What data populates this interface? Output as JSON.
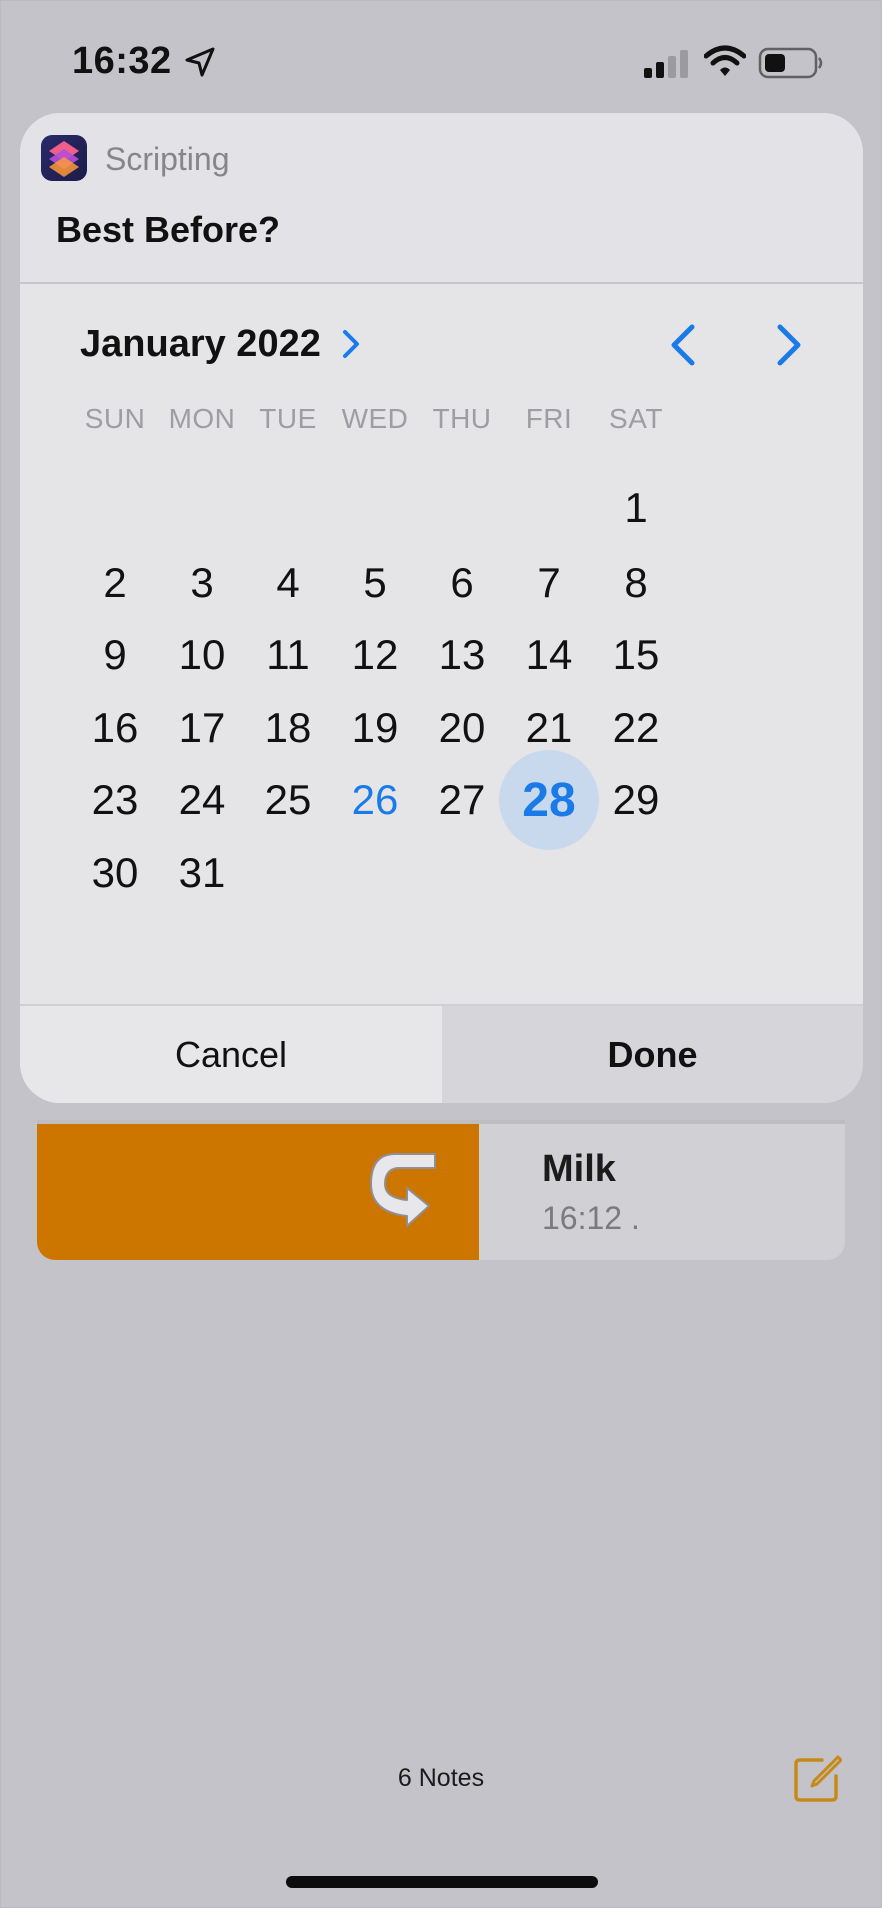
{
  "status_bar": {
    "time": "16:32"
  },
  "dialog": {
    "app_name": "Scripting",
    "title": "Best Before?",
    "month_label": "January 2022",
    "weekdays": [
      "SUN",
      "MON",
      "TUE",
      "WED",
      "THU",
      "FRI",
      "SAT"
    ],
    "days": [
      "1",
      "2",
      "3",
      "4",
      "5",
      "6",
      "7",
      "8",
      "9",
      "10",
      "11",
      "12",
      "13",
      "14",
      "15",
      "16",
      "17",
      "18",
      "19",
      "20",
      "21",
      "22",
      "23",
      "24",
      "25",
      "26",
      "27",
      "28",
      "29",
      "30",
      "31"
    ],
    "first_weekday_index": 6,
    "today": "26",
    "selected": "28",
    "cancel_label": "Cancel",
    "done_label": "Done"
  },
  "note": {
    "title": "Milk",
    "subtitle": "16:12  ."
  },
  "toolbar": {
    "notes_count": "6 Notes"
  },
  "colors": {
    "accent": "#1a7be8",
    "swipe_action": "#cc7600",
    "compose": "#c58a1a"
  },
  "icons": {
    "location": "location-arrow-icon",
    "signal": "cellular-signal-icon",
    "wifi": "wifi-icon",
    "battery": "battery-icon",
    "app": "scripting-app-icon",
    "month_chevron": "chevron-right-icon",
    "prev": "chevron-left-icon",
    "next": "chevron-right-icon",
    "swipe": "curved-arrow-icon",
    "compose": "compose-icon"
  }
}
